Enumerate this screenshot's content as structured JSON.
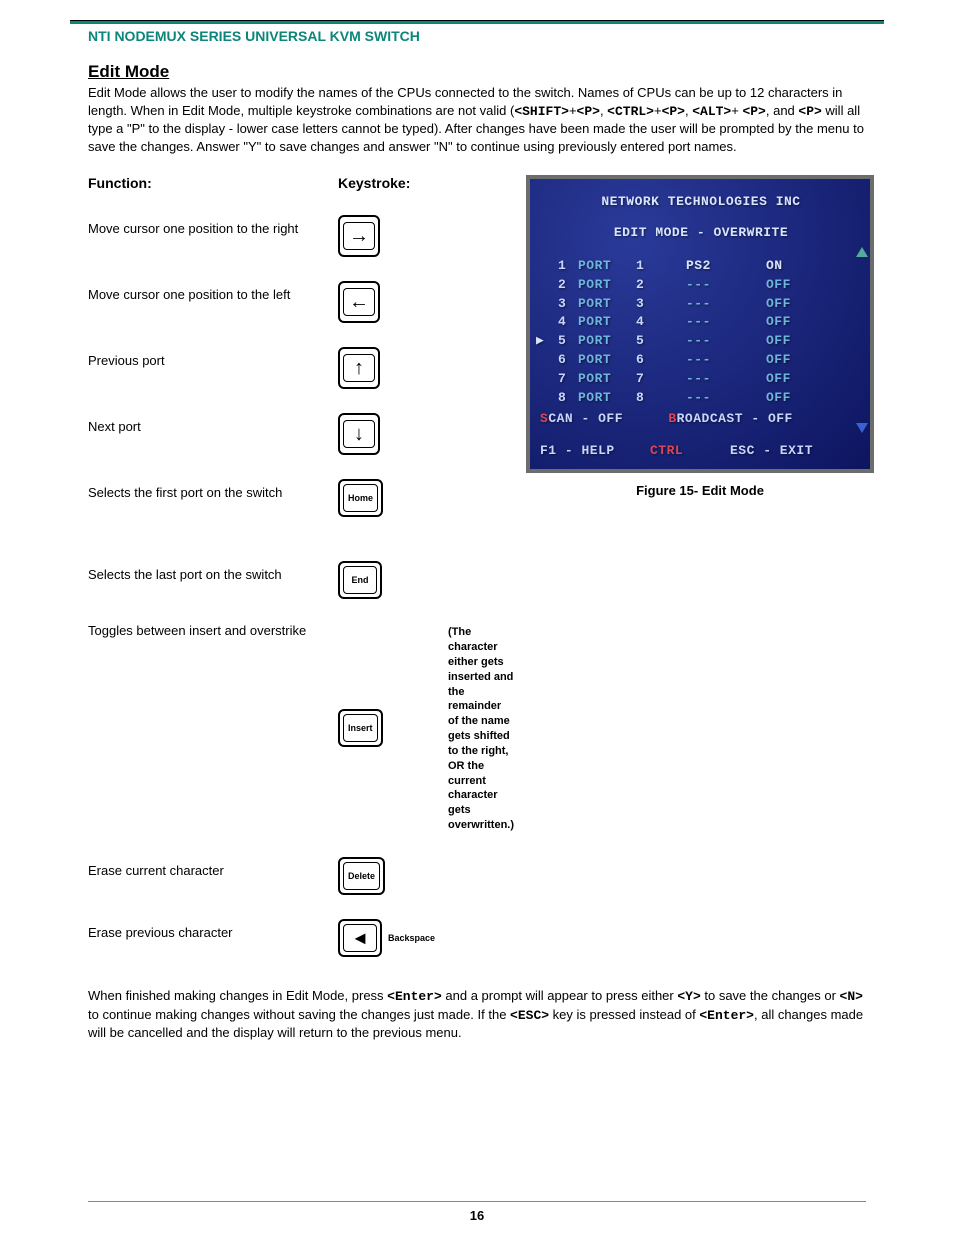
{
  "header": "NTI NODEMUX SERIES UNIVERSAL KVM SWITCH",
  "section_title": "Edit Mode",
  "intro": {
    "p1a": "Edit Mode allows the user to modify the names of the CPUs connected to the switch.  Names of CPUs can be up to 12 characters in length.  When in Edit Mode, multiple keystroke combinations are not valid (",
    "k1": "<SHIFT>",
    "s1": "+",
    "k2": "<P>",
    "s2": ", ",
    "k3": "<CTRL>",
    "s3": "+",
    "k4": "<P>",
    "s4": ", ",
    "k5": "<ALT>",
    "s5": "+ ",
    "k6": "<P>",
    "s6": ", and ",
    "k7": "<P>",
    "p1b": " will all type a \"P\" to the display - lower case letters cannot be typed). After changes have been made the user will be prompted by the menu to save the changes.  Answer \"Y\" to save changes and answer \"N\" to continue using previously entered port names."
  },
  "labels": {
    "function": "Function:",
    "keystroke": "Keystroke:"
  },
  "functions": [
    {
      "text": "Move cursor one position to the right",
      "key": "→"
    },
    {
      "text": "Move cursor one position to the left",
      "key": "←"
    },
    {
      "text": "Previous port",
      "key": "↑"
    },
    {
      "text": "Next port",
      "key": "↓"
    },
    {
      "text": "Selects the first port on the switch",
      "key": "Home"
    },
    {
      "text": "Selects the last port on the switch",
      "key": "End"
    },
    {
      "text": "Toggles between insert and overstrike",
      "key": "Insert",
      "note": "(The character either gets inserted and the remainder of the name gets shifted to the right,   OR   the current character gets overwritten.)"
    },
    {
      "text": "Erase current character",
      "key": "Delete"
    },
    {
      "text": "Erase previous character",
      "key": "Backspace",
      "bksp": true
    }
  ],
  "closing": {
    "a": "When finished making changes in Edit Mode, press ",
    "k1": "<Enter>",
    "b": " and a prompt will appear to press either ",
    "k2": "<Y>",
    "c": " to save the changes or ",
    "k3": "<N>",
    "d": " to continue making changes without saving the changes just made.      If the ",
    "k4": "<ESC>",
    "e": " key is pressed instead of ",
    "k5": "<Enter>",
    "f": ", all changes made will be cancelled and the display will return to the previous menu."
  },
  "screen": {
    "title": "NETWORK TECHNOLOGIES INC",
    "subtitle": "EDIT MODE - OVERWRITE",
    "ports": [
      {
        "n": "1",
        "name": "PORT",
        "idx": "1",
        "mid": "PS2",
        "state": "ON"
      },
      {
        "n": "2",
        "name": "PORT",
        "idx": "2",
        "mid": "---",
        "state": "OFF"
      },
      {
        "n": "3",
        "name": "PORT",
        "idx": "3",
        "mid": "---",
        "state": "OFF"
      },
      {
        "n": "4",
        "name": "PORT",
        "idx": "4",
        "mid": "---",
        "state": "OFF"
      },
      {
        "n": "5",
        "name": "PORT",
        "idx": "5",
        "mid": "---",
        "state": "OFF",
        "selected": true
      },
      {
        "n": "6",
        "name": "PORT",
        "idx": "6",
        "mid": "---",
        "state": "OFF"
      },
      {
        "n": "7",
        "name": "PORT",
        "idx": "7",
        "mid": "---",
        "state": "OFF"
      },
      {
        "n": "8",
        "name": "PORT",
        "idx": "8",
        "mid": "---",
        "state": "OFF"
      }
    ],
    "bottom": {
      "scan_s": "S",
      "scan": "CAN - OFF",
      "bc_b": "B",
      "bc": "ROADCAST - OFF"
    },
    "footer": {
      "f1": "F1 - HELP",
      "ctrl": "CTRL",
      "esc": "ESC - EXIT"
    }
  },
  "figure_caption": "Figure 15- Edit Mode",
  "page_number": "16"
}
